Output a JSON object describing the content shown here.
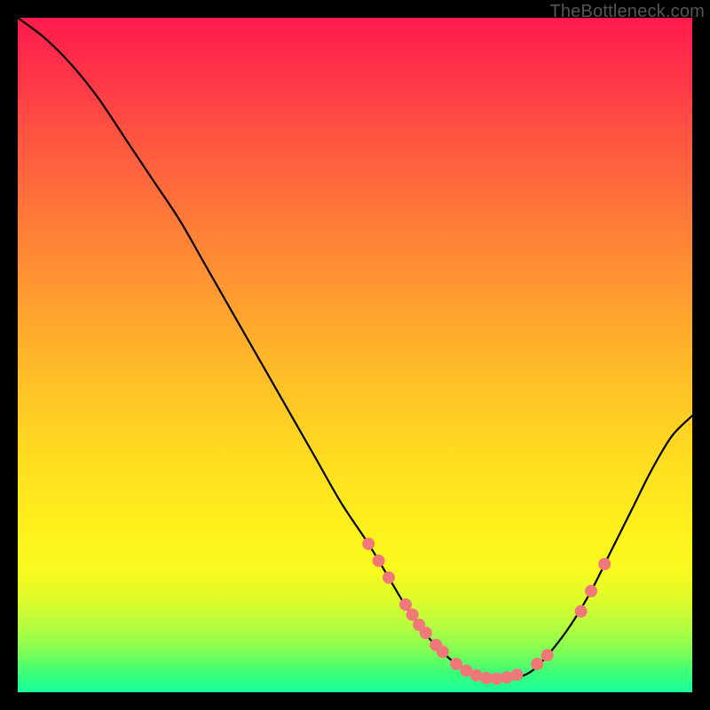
{
  "watermark": "TheBottleneck.com",
  "colors": {
    "curve": "#000000",
    "marker_fill": "#f07878",
    "marker_stroke": "#d85858",
    "background_black": "#000000"
  },
  "chart_data": {
    "type": "line",
    "title": "",
    "xlabel": "",
    "ylabel": "",
    "xlim": [
      0,
      100
    ],
    "ylim": [
      0,
      100
    ],
    "grid": false,
    "legend": false,
    "series": [
      {
        "name": "bottleneck-curve",
        "x": [
          0,
          4,
          8,
          12,
          16,
          20,
          24,
          28,
          32,
          36,
          40,
          44,
          48,
          52,
          55,
          58,
          61,
          64,
          67,
          70,
          73,
          76,
          79,
          82,
          85,
          88,
          91,
          94,
          97,
          100
        ],
        "y": [
          100,
          97,
          93,
          88,
          82,
          76,
          70,
          63,
          56,
          49,
          42,
          35,
          28,
          22,
          17,
          12,
          8,
          5,
          3,
          2,
          2,
          3,
          6,
          10,
          15,
          21,
          27,
          33,
          38,
          41
        ]
      }
    ],
    "markers": {
      "name": "highlighted-points",
      "points": [
        {
          "x": 52.0,
          "y": 22.0
        },
        {
          "x": 53.5,
          "y": 19.5
        },
        {
          "x": 55.0,
          "y": 17.0
        },
        {
          "x": 57.5,
          "y": 13.0
        },
        {
          "x": 58.5,
          "y": 11.5
        },
        {
          "x": 59.5,
          "y": 10.0
        },
        {
          "x": 60.5,
          "y": 8.8
        },
        {
          "x": 62.0,
          "y": 7.0
        },
        {
          "x": 63.0,
          "y": 6.0
        },
        {
          "x": 65.0,
          "y": 4.2
        },
        {
          "x": 66.5,
          "y": 3.2
        },
        {
          "x": 68.0,
          "y": 2.5
        },
        {
          "x": 69.5,
          "y": 2.1
        },
        {
          "x": 71.0,
          "y": 2.0
        },
        {
          "x": 72.5,
          "y": 2.2
        },
        {
          "x": 74.0,
          "y": 2.6
        },
        {
          "x": 77.0,
          "y": 4.2
        },
        {
          "x": 78.5,
          "y": 5.5
        },
        {
          "x": 83.5,
          "y": 12.0
        },
        {
          "x": 85.0,
          "y": 15.0
        },
        {
          "x": 87.0,
          "y": 19.0
        }
      ]
    }
  }
}
